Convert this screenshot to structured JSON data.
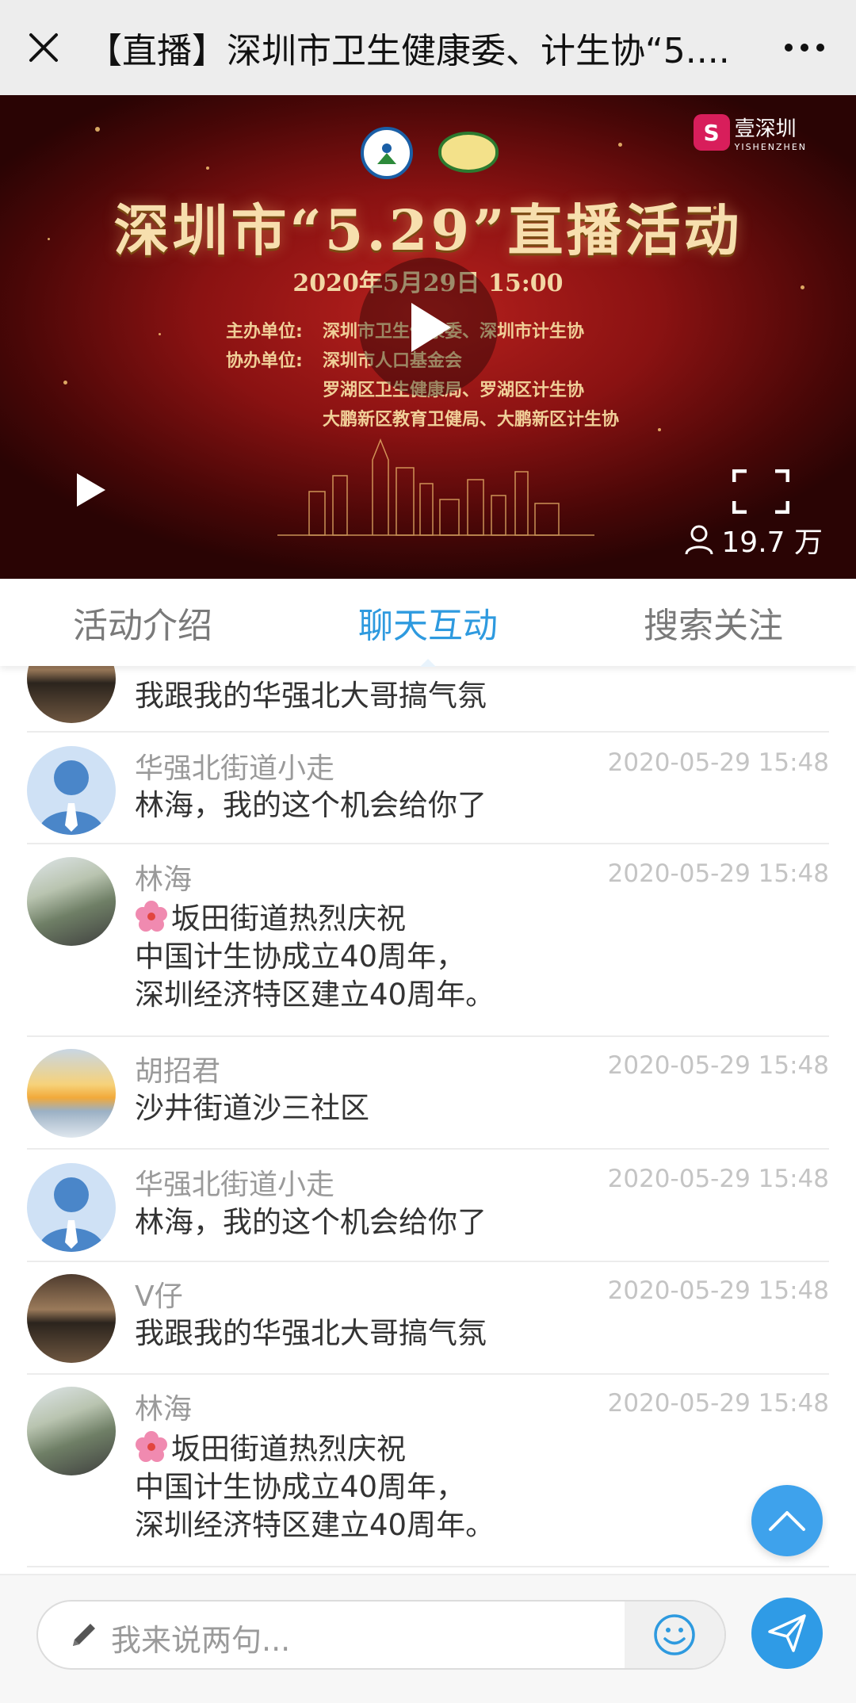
{
  "header": {
    "close_label": "close",
    "title": "【直播】深圳市卫生健康委、计生协“5....",
    "more_label": "···"
  },
  "video": {
    "brand_name": "壹深圳",
    "brand_sub": "YISHENZHEN",
    "poster_title": "深圳市“5.29”直播活动",
    "poster_date": "2020年5月29日 15:00",
    "organizers": [
      {
        "label": "主办单位:",
        "value": "深圳市卫生健康委、深圳市计生协"
      },
      {
        "label": "协办单位:",
        "value": "深圳市人口基金会"
      },
      {
        "label": "",
        "value": "罗湖区卫生健康局、罗湖区计生协"
      },
      {
        "label": "",
        "value": "大鹏新区教育卫健局、大鹏新区计生协"
      }
    ],
    "viewer_count": "19.7 万"
  },
  "tabs": [
    {
      "label": "活动介绍",
      "active": false
    },
    {
      "label": "聊天互动",
      "active": true
    },
    {
      "label": "搜索关注",
      "active": false
    }
  ],
  "messages": [
    {
      "name": "",
      "time": "",
      "lines": [
        "我跟我的华强北大哥搞气氛"
      ],
      "avatar": "lake"
    },
    {
      "name": "华强北街道小走",
      "time": "2020-05-29 15:48",
      "lines": [
        "林海，我的这个机会给你了"
      ],
      "avatar": "person"
    },
    {
      "name": "林海",
      "time": "2020-05-29 15:48",
      "lines": [
        "坂田街道热烈庆祝",
        "中国计生协成立40周年，",
        "深圳经济特区建立40周年。"
      ],
      "avatar": "street",
      "flower": true
    },
    {
      "name": "胡招君",
      "time": "2020-05-29 15:48",
      "lines": [
        "沙井街道沙三社区"
      ],
      "avatar": "sunset"
    },
    {
      "name": "华强北街道小走",
      "time": "2020-05-29 15:48",
      "lines": [
        "林海，我的这个机会给你了"
      ],
      "avatar": "person"
    },
    {
      "name": "V仔",
      "time": "2020-05-29 15:48",
      "lines": [
        "我跟我的华强北大哥搞气氛"
      ],
      "avatar": "lake"
    },
    {
      "name": "林海",
      "time": "2020-05-29 15:48",
      "lines": [
        "坂田街道热烈庆祝",
        "中国计生协成立40周年，",
        "深圳经济特区建立40周年。"
      ],
      "avatar": "street",
      "flower": true
    }
  ],
  "input": {
    "placeholder": "我来说两句..."
  },
  "colors": {
    "accent": "#2e9adf",
    "send": "#2f9be6",
    "scroll_top": "#3ea2ec"
  }
}
